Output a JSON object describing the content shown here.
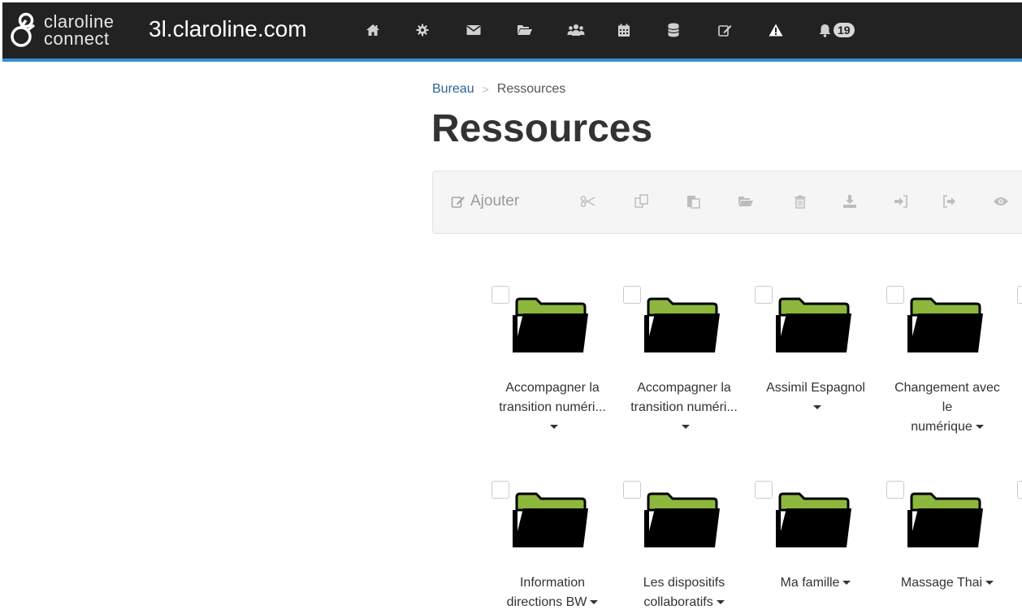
{
  "brand": {
    "word_line1": "claroline",
    "word_line2": "connect",
    "site": "3l.claroline.com"
  },
  "nav": {
    "icons": [
      "home-icon",
      "gear-icon",
      "envelope-icon",
      "folder-open-icon",
      "users-icon",
      "calendar-icon",
      "database-icon",
      "edit-icon",
      "warning-icon",
      "bell-icon"
    ],
    "notifications_count": "19"
  },
  "breadcrumb": {
    "root": "Bureau",
    "separator": ">",
    "current": "Ressources"
  },
  "page": {
    "title": "Ressources"
  },
  "toolbar": {
    "add_label": "Ajouter",
    "buttons": [
      "cut-icon",
      "copy-icon",
      "paste-icon",
      "move-icon",
      "delete-icon",
      "download-icon",
      "import-icon",
      "export-icon",
      "view-icon"
    ]
  },
  "resources": [
    {
      "line1": "Accompagner la",
      "line2": "transition numéri...",
      "line3": ""
    },
    {
      "line1": "Accompagner la",
      "line2": "transition numéri...",
      "line3": ""
    },
    {
      "line1": "Assimil Espagnol",
      "line2": "",
      "line3": ""
    },
    {
      "line1": "Changement avec",
      "line2": "le",
      "line3": "numérique"
    },
    {
      "line1": "Information",
      "line2": "directions BW",
      "line3": ""
    },
    {
      "line1": "Les dispositifs",
      "line2": "collaboratifs",
      "line3": ""
    },
    {
      "line1": "Ma famille",
      "line2": "",
      "line3": ""
    },
    {
      "line1": "Massage Thai",
      "line2": "",
      "line3": ""
    }
  ],
  "colors": {
    "navbar": "#222222",
    "navbar_accent": "#2f8fd6",
    "folder_tab": "#8db63c",
    "folder_body": "#000000",
    "link": "#2a6496"
  }
}
